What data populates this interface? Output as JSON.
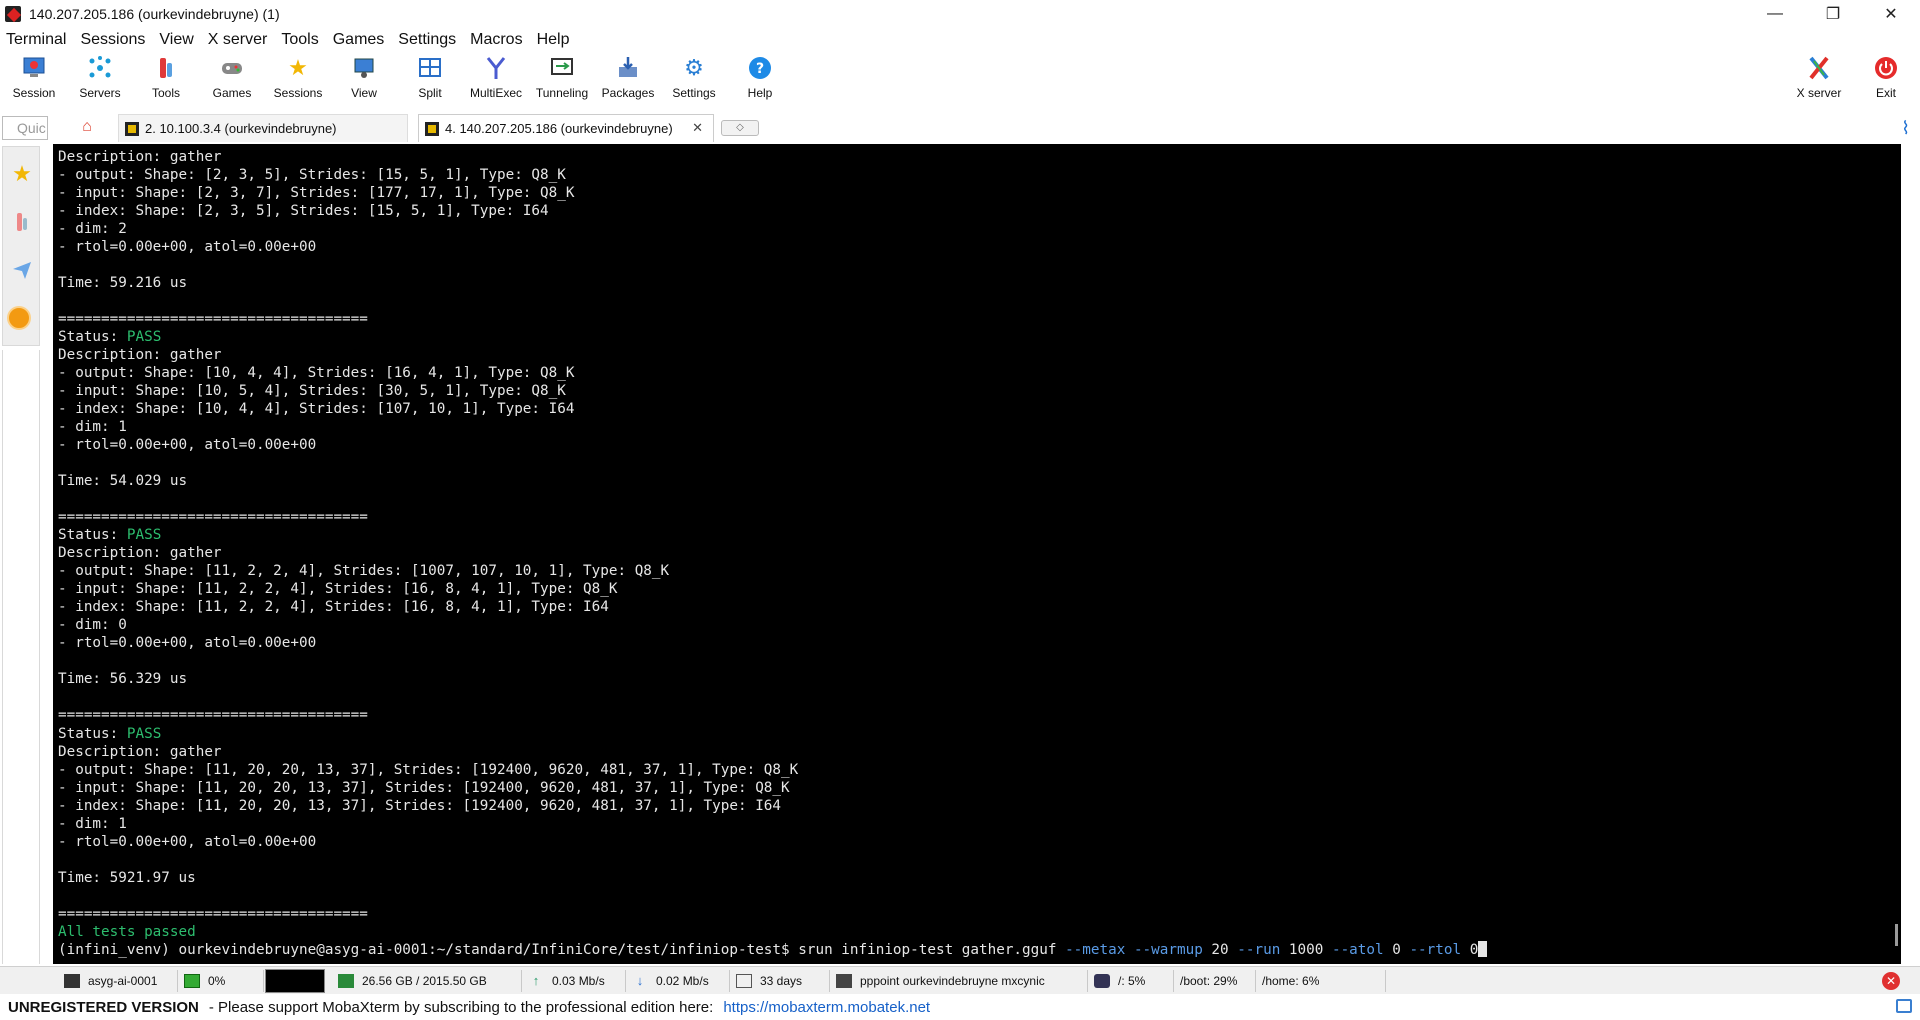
{
  "window": {
    "title": "140.207.205.186 (ourkevindebruyne) (1)",
    "controls": {
      "minimize": "—",
      "maximize": "❐",
      "close": "✕"
    }
  },
  "menu": [
    "Terminal",
    "Sessions",
    "View",
    "X server",
    "Tools",
    "Games",
    "Settings",
    "Macros",
    "Help"
  ],
  "toolbar": {
    "session": "Session",
    "servers": "Servers",
    "tools": "Tools",
    "games": "Games",
    "sessions": "Sessions",
    "view": "View",
    "split": "Split",
    "multiexec": "MultiExec",
    "tunneling": "Tunneling",
    "packages": "Packages",
    "settings": "Settings",
    "help": "Help",
    "xserver": "X server",
    "exit": "Exit"
  },
  "tabs": {
    "quick_connect_placeholder": "Quic",
    "items": [
      {
        "label": "2. 10.100.3.4 (ourkevindebruyne)",
        "active": false
      },
      {
        "label": "4. 140.207.205.186 (ourkevindebruyne)",
        "active": true
      }
    ],
    "close_glyph": "✕",
    "new_tab_glyph": "◇"
  },
  "terminal": {
    "lines": [
      "Description: gather",
      "- output: Shape: [2, 3, 5], Strides: [15, 5, 1], Type: Q8_K",
      "- input: Shape: [2, 3, 7], Strides: [177, 17, 1], Type: Q8_K",
      "- index: Shape: [2, 3, 5], Strides: [15, 5, 1], Type: I64",
      "- dim: 2",
      "- rtol=0.00e+00, atol=0.00e+00",
      "",
      "Time: 59.216 us",
      "",
      "====================================",
      "Status: PASS",
      "Description: gather",
      "- output: Shape: [10, 4, 4], Strides: [16, 4, 1], Type: Q8_K",
      "- input: Shape: [10, 5, 4], Strides: [30, 5, 1], Type: Q8_K",
      "- index: Shape: [10, 4, 4], Strides: [107, 10, 1], Type: I64",
      "- dim: 1",
      "- rtol=0.00e+00, atol=0.00e+00",
      "",
      "Time: 54.029 us",
      "",
      "====================================",
      "Status: PASS",
      "Description: gather",
      "- output: Shape: [11, 2, 2, 4], Strides: [1007, 107, 10, 1], Type: Q8_K",
      "- input: Shape: [11, 2, 2, 4], Strides: [16, 8, 4, 1], Type: Q8_K",
      "- index: Shape: [11, 2, 2, 4], Strides: [16, 8, 4, 1], Type: I64",
      "- dim: 0",
      "- rtol=0.00e+00, atol=0.00e+00",
      "",
      "Time: 56.329 us",
      "",
      "====================================",
      "Status: PASS",
      "Description: gather",
      "- output: Shape: [11, 20, 20, 13, 37], Strides: [192400, 9620, 481, 37, 1], Type: Q8_K",
      "- input: Shape: [11, 20, 20, 13, 37], Strides: [192400, 9620, 481, 37, 1], Type: Q8_K",
      "- index: Shape: [11, 20, 20, 13, 37], Strides: [192400, 9620, 481, 37, 1], Type: I64",
      "- dim: 1",
      "- rtol=0.00e+00, atol=0.00e+00",
      "",
      "Time: 5921.97 us",
      "",
      "===================================="
    ],
    "all_passed": "All tests passed",
    "prompt": "(infini_venv) ourkevindebruyne@asyg-ai-0001:~/standard/InfiniCore/test/infiniop-test$ srun infiniop-test gather.gguf ",
    "command_parts": [
      {
        "text": "--metax",
        "kind": "opt"
      },
      {
        "text": " ",
        "kind": "plain"
      },
      {
        "text": "--warmup",
        "kind": "opt"
      },
      {
        "text": " 20 ",
        "kind": "plain"
      },
      {
        "text": "--run",
        "kind": "opt"
      },
      {
        "text": " 1000 ",
        "kind": "plain"
      },
      {
        "text": "--atol",
        "kind": "opt"
      },
      {
        "text": " 0 ",
        "kind": "plain"
      },
      {
        "text": "--rtol",
        "kind": "opt"
      },
      {
        "text": " 0",
        "kind": "plain"
      }
    ]
  },
  "statusbar": {
    "host": "asyg-ai-0001",
    "cpu": "0%",
    "memory": "26.56 GB / 2015.50 GB",
    "upload": "0.03 Mb/s",
    "download": "0.02 Mb/s",
    "uptime": "33 days",
    "users": "pppoint  ourkevindebruyne  mxcynic",
    "disk_root": "/: 5%",
    "disk_boot": "/boot: 29%",
    "disk_home": "/home: 6%"
  },
  "footer": {
    "unregistered": "UNREGISTERED VERSION",
    "message": "-  Please support MobaXterm by subscribing to the professional edition here:",
    "link": "https://mobaxterm.mobatek.net"
  },
  "colors": {
    "terminal_bg": "#000000",
    "terminal_fg": "#e6e6e6",
    "pass": "#2dbd6e",
    "option": "#5a9be6"
  }
}
